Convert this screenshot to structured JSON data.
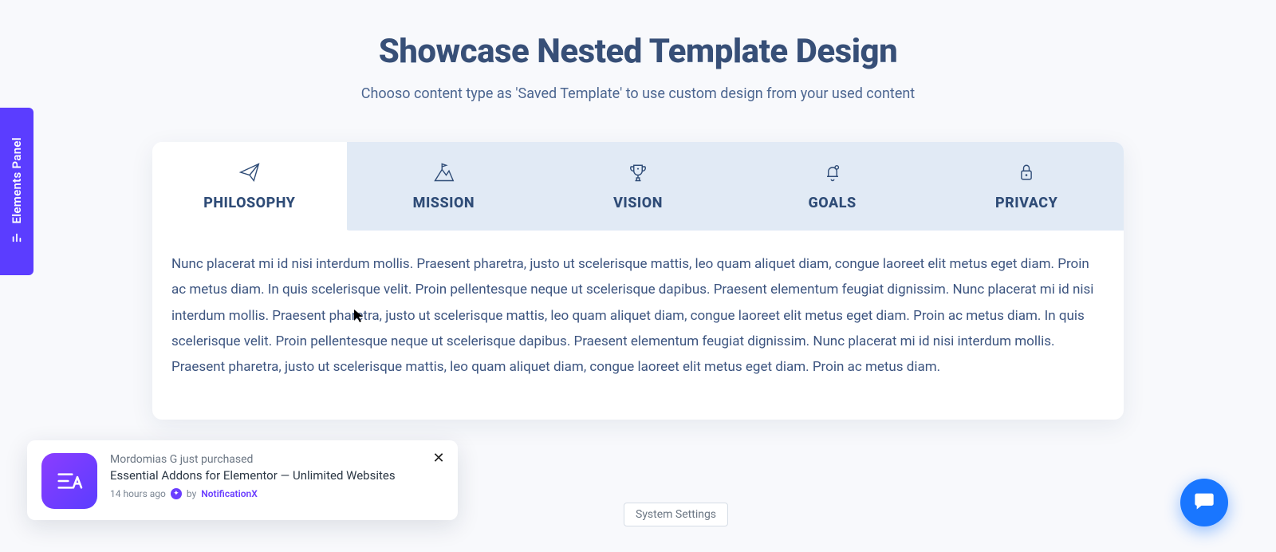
{
  "side_panel": {
    "label": "Elements Panel"
  },
  "header": {
    "title": "Showcase Nested Template Design",
    "subtitle": "Chooso content type as 'Saved Template' to use custom design from your used content"
  },
  "tabs": [
    {
      "label": "PHILOSOPHY",
      "active": true
    },
    {
      "label": "MISSION",
      "active": false
    },
    {
      "label": "VISION",
      "active": false
    },
    {
      "label": "GOALS",
      "active": false
    },
    {
      "label": "PRIVACY",
      "active": false
    }
  ],
  "content": {
    "body": "Nunc placerat mi id nisi interdum mollis. Praesent pharetra, justo ut scelerisque mattis, leo quam aliquet diam, congue laoreet elit metus eget diam. Proin ac metus diam. In quis scelerisque velit. Proin pellentesque neque ut scelerisque dapibus. Praesent elementum feugiat dignissim. Nunc placerat mi id nisi interdum mollis. Praesent pharetra, justo ut scelerisque mattis, leo quam aliquet diam, congue laoreet elit metus eget diam. Proin ac metus diam. In quis scelerisque velit. Proin pellentesque neque ut scelerisque dapibus. Praesent elementum feugiat dignissim. Nunc placerat mi id nisi interdum mollis. Praesent pharetra, justo ut scelerisque mattis, leo quam aliquet diam, congue laoreet elit metus eget diam. Proin ac metus diam."
  },
  "notification": {
    "line1": "Mordomias G just purchased",
    "title": "Essential Addons for Elementor — Unlimited Websites",
    "time": "14 hours ago",
    "by": "by",
    "brand": "NotificationX"
  },
  "system_settings": {
    "label": "System Settings"
  }
}
